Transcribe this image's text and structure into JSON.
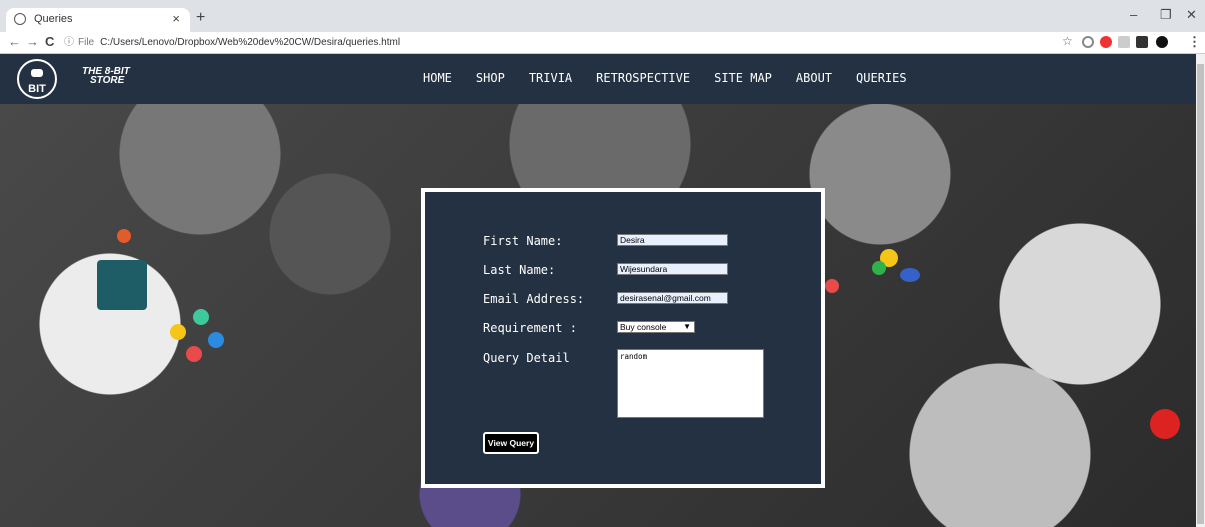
{
  "browser": {
    "tab_title": "Queries",
    "tab_close": "×",
    "new_tab": "+",
    "minimize": "–",
    "restore": "❐",
    "close": "✕",
    "back": "←",
    "forward": "→",
    "reload": "C",
    "file_label": "File",
    "url": "C:/Users/Lenovo/Dropbox/Web%20dev%20CW/Desira/queries.html",
    "bookmark": "☆",
    "menu": "⋮"
  },
  "site": {
    "logo_number": "8",
    "logo_bit": "BIT",
    "logo_text_line1": "THE 8-BIT",
    "logo_text_line2": "STORE",
    "nav": [
      "HOME",
      "SHOP",
      "TRIVIA",
      "RETROSPECTIVE",
      "SITE MAP",
      "ABOUT",
      "QUERIES"
    ]
  },
  "form": {
    "first_name_label": "First Name:",
    "first_name_value": "Desira",
    "last_name_label": "Last Name:",
    "last_name_value": "Wijesundara",
    "email_label": "Email Address:",
    "email_value": "desirasenal@gmail.com",
    "requirement_label": "Requirement :",
    "requirement_value": "Buy console",
    "query_label": "Query Detail",
    "query_value": "random",
    "button_label": "View Query"
  },
  "colors": {
    "navbar": "#243142",
    "form_bg": "#243142"
  }
}
